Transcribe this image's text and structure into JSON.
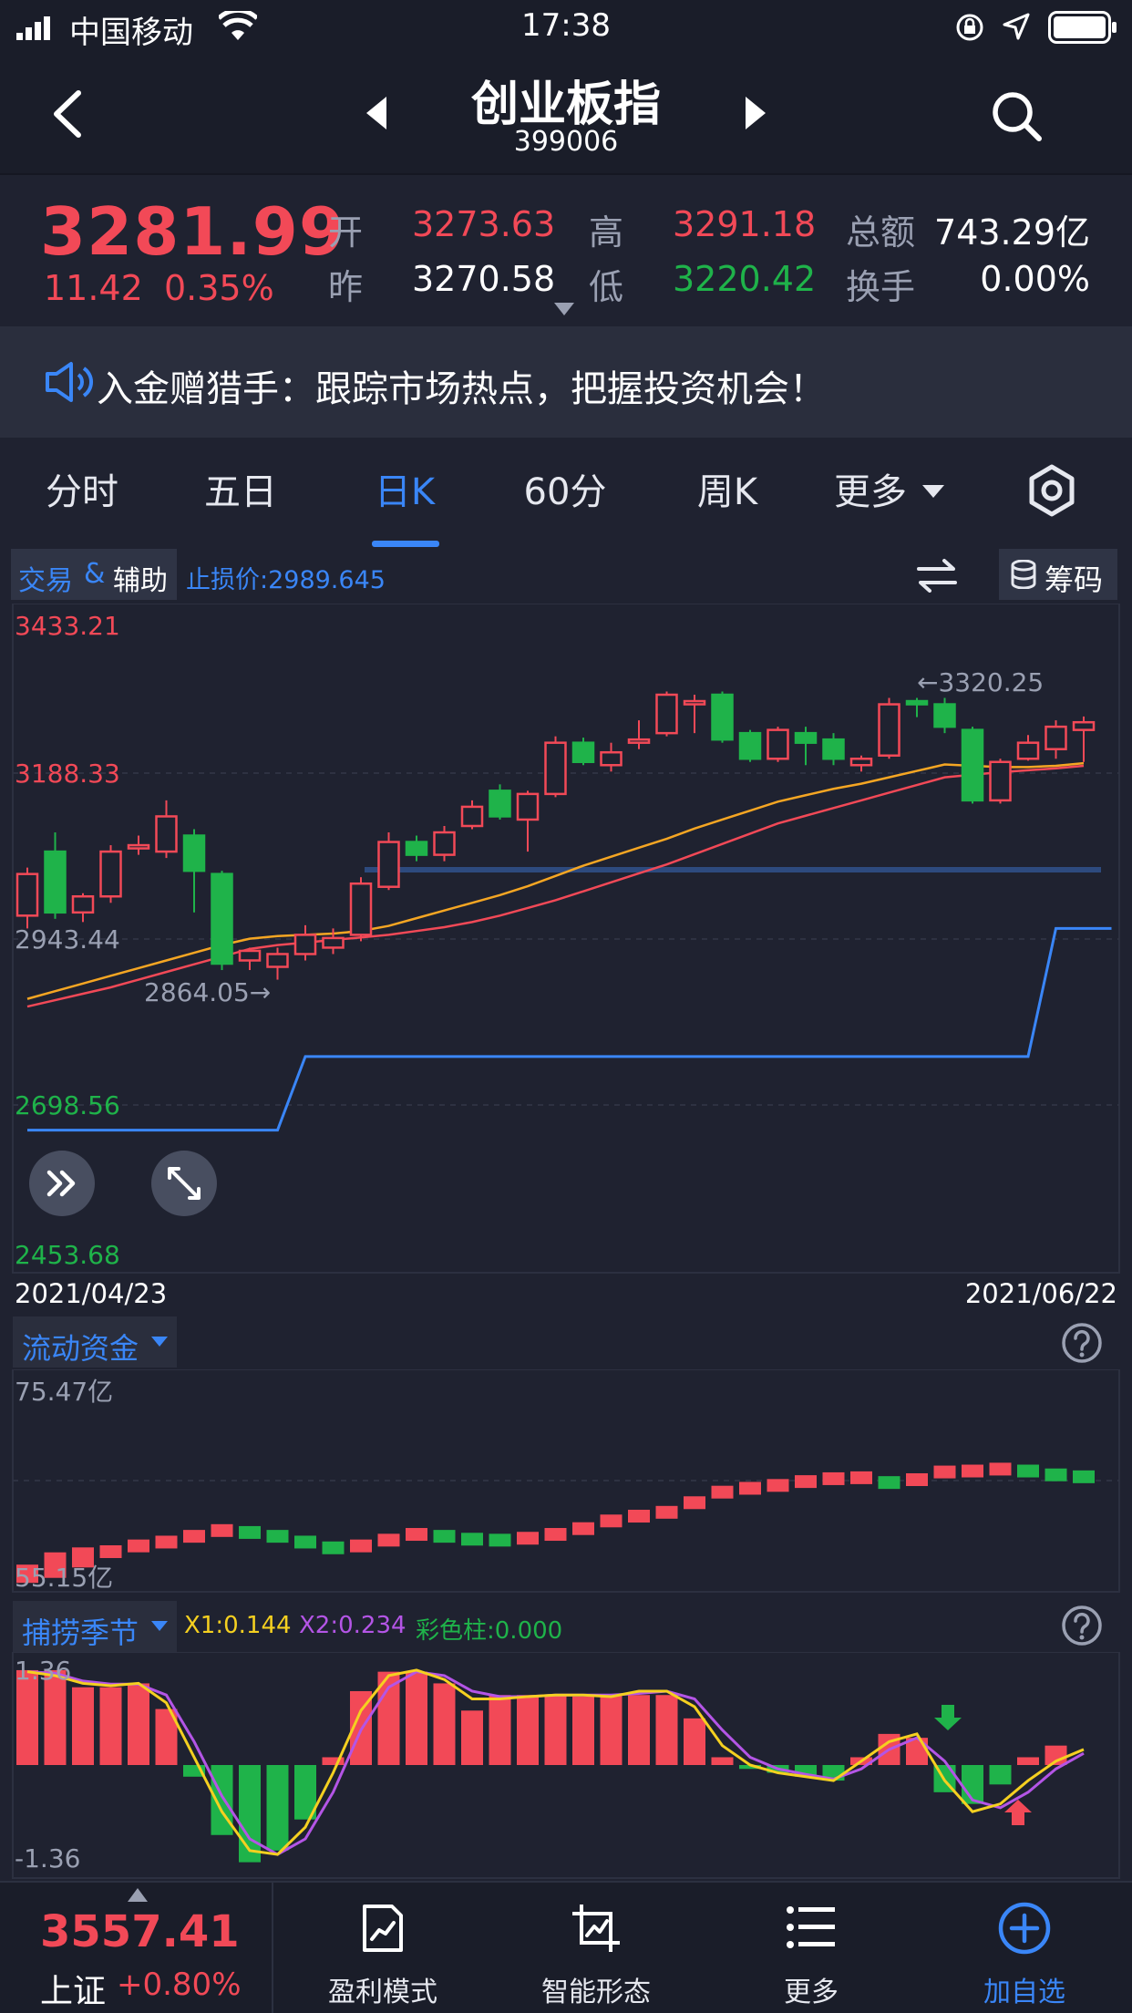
{
  "status_bar": {
    "carrier": "中国移动",
    "time": "17:38"
  },
  "nav": {
    "title": "创业板指",
    "code": "399006"
  },
  "quote": {
    "price": "3281.99",
    "change": "11.42",
    "change_pct": "0.35%",
    "open_label": "开",
    "open": "3273.63",
    "prev_label": "昨",
    "prev": "3270.58",
    "high_label": "高",
    "high": "3291.18",
    "low_label": "低",
    "low": "3220.42",
    "amount_label": "总额",
    "amount": "743.29亿",
    "turnover_label": "换手",
    "turnover": "0.00%"
  },
  "banner": {
    "text": "入金赠猎手：跟踪市场热点，把握投资机会！"
  },
  "tabs": [
    {
      "label": "分时"
    },
    {
      "label": "五日"
    },
    {
      "label": "日K"
    },
    {
      "label": "60分"
    },
    {
      "label": "周K"
    },
    {
      "label": "更多"
    }
  ],
  "chart_toolbar": {
    "trade_label": "交易",
    "amp": "&",
    "assist_label": "辅助",
    "stop_loss": "止损价:2989.645",
    "chips_label": "筹码"
  },
  "main_axis": {
    "labels": [
      "3433.21",
      "3188.33",
      "2943.44",
      "2698.56",
      "2453.68"
    ],
    "date_start": "2021/04/23",
    "date_end": "2021/06/22",
    "hi_annotation": "←3320.25",
    "lo_annotation": "2864.05→"
  },
  "flow_panel": {
    "title": "流动资金",
    "max_label": "75.47亿",
    "min_label": "55.15亿"
  },
  "season_panel": {
    "title": "捕捞季节",
    "x1": "X1:0.144",
    "x2": "X2:0.234",
    "bar": "彩色柱:0.000",
    "max_label": "1.36",
    "min_label": "-1.36"
  },
  "bottom_bar": {
    "index_value": "3557.41",
    "index_name": "上证",
    "index_change": "+0.80%",
    "items": [
      {
        "label": "盈利模式",
        "icon": "chart-line-icon"
      },
      {
        "label": "智能形态",
        "icon": "crop-chart-icon"
      },
      {
        "label": "更多",
        "icon": "list-icon"
      },
      {
        "label": "加自选",
        "icon": "add-circle-icon"
      }
    ]
  },
  "colors": {
    "up": "#f24957",
    "down": "#1fb34a",
    "accent": "#3a86f7",
    "ma5": "#f5a623",
    "ma10": "#f24957"
  },
  "chart_data": [
    {
      "type": "candlestick",
      "ylim": [
        2453.68,
        3433.21
      ],
      "candles": [
        {
          "o": 2980,
          "c": 3045,
          "h": 3055,
          "l": 2960
        },
        {
          "o": 3080,
          "c": 2985,
          "h": 3110,
          "l": 2975
        },
        {
          "o": 2985,
          "c": 3010,
          "h": 3015,
          "l": 2970
        },
        {
          "o": 3010,
          "c": 3080,
          "h": 3090,
          "l": 3000
        },
        {
          "o": 3085,
          "c": 3090,
          "h": 3105,
          "l": 3075
        },
        {
          "o": 3080,
          "c": 3135,
          "h": 3160,
          "l": 3070
        },
        {
          "o": 3105,
          "c": 3050,
          "h": 3115,
          "l": 2985
        },
        {
          "o": 3045,
          "c": 2905,
          "h": 3050,
          "l": 2895
        },
        {
          "o": 2910,
          "c": 2925,
          "h": 2930,
          "l": 2895
        },
        {
          "o": 2900,
          "c": 2920,
          "h": 2930,
          "l": 2880
        },
        {
          "o": 2920,
          "c": 2950,
          "h": 2965,
          "l": 2910
        },
        {
          "o": 2930,
          "c": 2945,
          "h": 2960,
          "l": 2920
        },
        {
          "o": 2950,
          "c": 3030,
          "h": 3040,
          "l": 2940
        },
        {
          "o": 3025,
          "c": 3095,
          "h": 3110,
          "l": 3020
        },
        {
          "o": 3095,
          "c": 3075,
          "h": 3105,
          "l": 3065
        },
        {
          "o": 3075,
          "c": 3110,
          "h": 3120,
          "l": 3065
        },
        {
          "o": 3120,
          "c": 3150,
          "h": 3160,
          "l": 3115
        },
        {
          "o": 3175,
          "c": 3135,
          "h": 3185,
          "l": 3130
        },
        {
          "o": 3130,
          "c": 3170,
          "h": 3175,
          "l": 3080
        },
        {
          "o": 3170,
          "c": 3250,
          "h": 3260,
          "l": 3165
        },
        {
          "o": 3250,
          "c": 3220,
          "h": 3258,
          "l": 3215
        },
        {
          "o": 3215,
          "c": 3235,
          "h": 3250,
          "l": 3205
        },
        {
          "o": 3250,
          "c": 3255,
          "h": 3285,
          "l": 3240
        },
        {
          "o": 3265,
          "c": 3325,
          "h": 3330,
          "l": 3260
        },
        {
          "o": 3310,
          "c": 3315,
          "h": 3325,
          "l": 3265
        },
        {
          "o": 3325,
          "c": 3255,
          "h": 3330,
          "l": 3250
        },
        {
          "o": 3265,
          "c": 3225,
          "h": 3270,
          "l": 3220
        },
        {
          "o": 3225,
          "c": 3270,
          "h": 3275,
          "l": 3220
        },
        {
          "o": 3265,
          "c": 3250,
          "h": 3275,
          "l": 3215
        },
        {
          "o": 3255,
          "c": 3225,
          "h": 3265,
          "l": 3215
        },
        {
          "o": 3215,
          "c": 3225,
          "h": 3230,
          "l": 3205
        },
        {
          "o": 3230,
          "c": 3310,
          "h": 3320,
          "l": 3225
        },
        {
          "o": 3315,
          "c": 3310,
          "h": 3320,
          "l": 3290
        },
        {
          "o": 3310,
          "c": 3275,
          "h": 3320,
          "l": 3265
        },
        {
          "o": 3270,
          "c": 3160,
          "h": 3275,
          "l": 3155
        },
        {
          "o": 3160,
          "c": 3220,
          "h": 3225,
          "l": 3155
        },
        {
          "o": 3225,
          "c": 3250,
          "h": 3262,
          "l": 3222
        },
        {
          "o": 3240,
          "c": 3275,
          "h": 3285,
          "l": 3225
        },
        {
          "o": 3270,
          "c": 3282,
          "h": 3291,
          "l": 3220
        }
      ],
      "ma_a": [
        2850,
        2862,
        2874,
        2886,
        2898,
        2910,
        2922,
        2934,
        2944,
        2948,
        2950,
        2952,
        2956,
        2964,
        2976,
        2988,
        3000,
        3012,
        3026,
        3042,
        3058,
        3072,
        3086,
        3100,
        3116,
        3130,
        3144,
        3158,
        3168,
        3178,
        3186,
        3196,
        3206,
        3216,
        3214,
        3212,
        3212,
        3214,
        3218
      ],
      "ma_b": [
        2838,
        2848,
        2858,
        2868,
        2880,
        2892,
        2904,
        2916,
        2928,
        2934,
        2938,
        2942,
        2946,
        2950,
        2956,
        2962,
        2970,
        2980,
        2992,
        3004,
        3018,
        3032,
        3046,
        3060,
        3076,
        3092,
        3108,
        3124,
        3136,
        3148,
        3160,
        3172,
        3184,
        3196,
        3200,
        3204,
        3207,
        3210,
        3214
      ],
      "stop_line": [
        2645,
        2645,
        2645,
        2645,
        2645,
        2645,
        2645,
        2645,
        2645,
        2645,
        2760,
        2760,
        2760,
        2760,
        2760,
        2760,
        2760,
        2760,
        2760,
        2760,
        2760,
        2760,
        2760,
        2760,
        2760,
        2760,
        2760,
        2760,
        2760,
        2760,
        2760,
        2760,
        2760,
        2760,
        2760,
        2760,
        2760,
        2960,
        2960,
        2960
      ]
    },
    {
      "type": "bar",
      "title": "流动资金",
      "ylim": [
        55.15,
        75.47
      ],
      "values": [
        55.7,
        56.6,
        57.4,
        58.0,
        58.6,
        59.0,
        59.6,
        60.2,
        60.0,
        59.6,
        59.0,
        58.4,
        58.6,
        59.2,
        59.8,
        59.6,
        59.3,
        59.2,
        59.4,
        59.8,
        60.4,
        61.2,
        61.7,
        62.1,
        63.1,
        64.2,
        64.6,
        64.9,
        65.3,
        65.6,
        65.7,
        65.2,
        65.5,
        66.3,
        66.4,
        66.6,
        66.4,
        66.0,
        65.8
      ]
    },
    {
      "type": "bar",
      "title": "捕捞季节",
      "ylim": [
        -1.36,
        1.36
      ],
      "values": [
        1.22,
        1.22,
        1.0,
        1.0,
        1.05,
        0.72,
        -0.15,
        -0.9,
        -1.25,
        -1.1,
        -0.7,
        0.1,
        0.95,
        1.2,
        1.2,
        1.05,
        0.7,
        0.9,
        0.9,
        0.9,
        0.88,
        0.9,
        0.9,
        0.9,
        0.6,
        0.1,
        -0.05,
        -0.1,
        -0.15,
        -0.2,
        0.1,
        0.4,
        0.35,
        -0.35,
        -0.5,
        -0.25,
        0.1,
        0.25
      ],
      "x1": [
        1.2,
        1.15,
        1.05,
        1.02,
        1.05,
        0.8,
        0.1,
        -0.6,
        -1.1,
        -1.15,
        -0.8,
        -0.1,
        0.7,
        1.15,
        1.22,
        1.1,
        0.85,
        0.85,
        0.88,
        0.9,
        0.9,
        0.88,
        0.95,
        0.95,
        0.75,
        0.25,
        0.0,
        -0.1,
        -0.15,
        -0.2,
        0.05,
        0.3,
        0.4,
        -0.2,
        -0.6,
        -0.5,
        -0.2,
        0.05,
        0.2
      ],
      "x2": [
        1.2,
        1.18,
        1.08,
        1.04,
        1.04,
        0.9,
        0.3,
        -0.4,
        -0.95,
        -1.15,
        -0.95,
        -0.35,
        0.45,
        1.0,
        1.2,
        1.15,
        0.95,
        0.88,
        0.88,
        0.9,
        0.9,
        0.9,
        0.92,
        0.95,
        0.85,
        0.45,
        0.1,
        -0.05,
        -0.12,
        -0.18,
        -0.05,
        0.2,
        0.35,
        0.05,
        -0.45,
        -0.55,
        -0.35,
        -0.05,
        0.15
      ]
    }
  ]
}
